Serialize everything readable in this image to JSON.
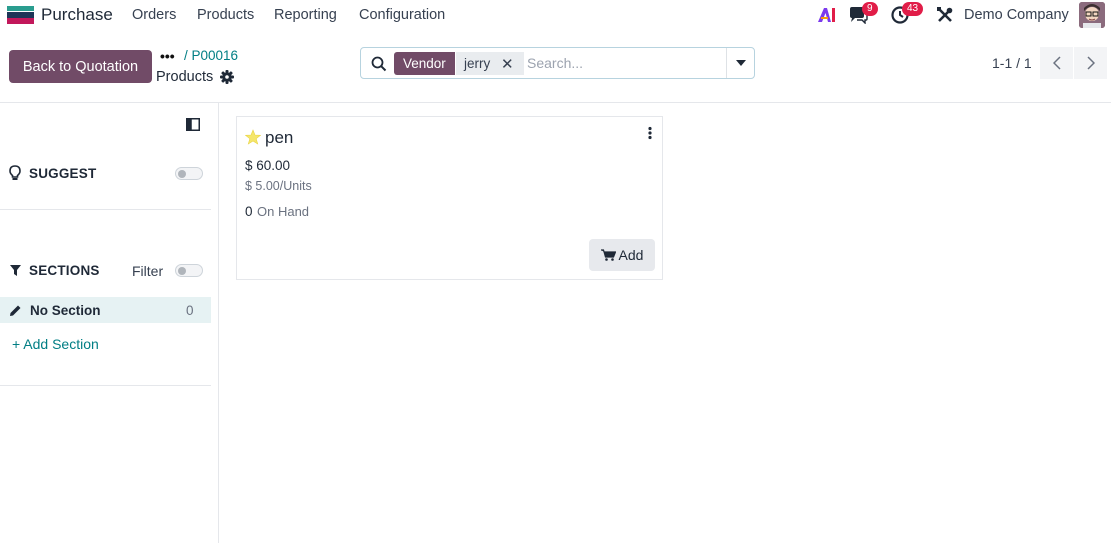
{
  "navbar": {
    "app_name": "Purchase",
    "menu": [
      "Orders",
      "Products",
      "Reporting",
      "Configuration"
    ],
    "chat_badge": "9",
    "activity_badge": "43",
    "company": "Demo Company",
    "icons": [
      "app-logo",
      "ai-icon",
      "chat-icon",
      "activity-clock-icon",
      "tools-icon",
      "avatar"
    ]
  },
  "control_panel": {
    "back_button": "Back to Quotation",
    "breadcrumb_dots": "•••",
    "breadcrumb_link": "/ P00016",
    "breadcrumb_current": "Products",
    "search": {
      "facet_label": "Vendor",
      "facet_value": "jerry",
      "facet_close": "✕",
      "placeholder": "Search..."
    },
    "pager": "1-1 / 1"
  },
  "sidebar": {
    "suggest_title": "SUGGEST",
    "sections_title": "SECTIONS",
    "filter_label": "Filter",
    "no_section_label": "No Section",
    "no_section_count": "0",
    "add_section_label": "+ Add Section"
  },
  "product_card": {
    "name": "pen",
    "price": "$ 60.00",
    "unit_price": "$ 5.00/Units",
    "on_hand_qty": "0",
    "on_hand_label": "On Hand",
    "add_label": "Add"
  },
  "colors": {
    "brand": "#714b67",
    "link": "#017e84",
    "badge": "#e11d48",
    "section_highlight": "#e6f2f3"
  }
}
